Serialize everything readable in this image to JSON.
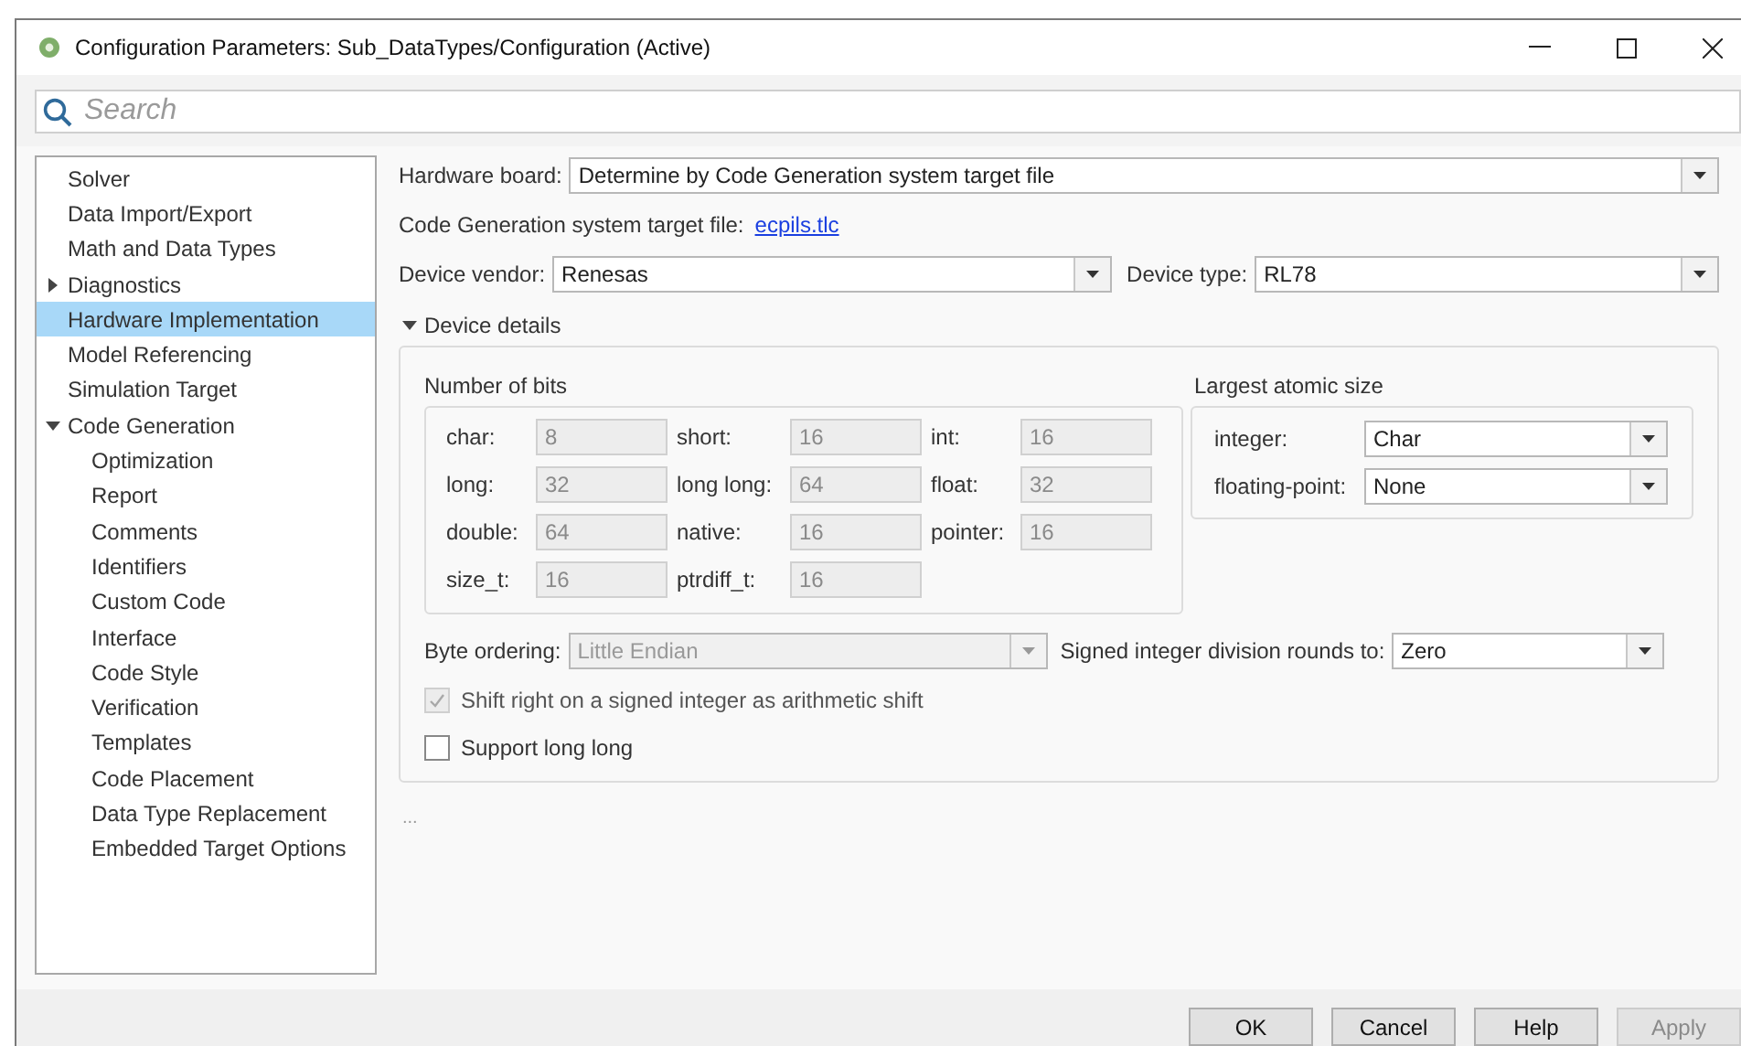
{
  "window": {
    "title": "Configuration Parameters: Sub_DataTypes/Configuration (Active)"
  },
  "search": {
    "placeholder": "Search"
  },
  "sidebar": {
    "items": [
      {
        "label": "Solver",
        "selected": false
      },
      {
        "label": "Data Import/Export",
        "selected": false
      },
      {
        "label": "Math and Data Types",
        "selected": false
      },
      {
        "label": "Diagnostics",
        "selected": false,
        "expanded": false
      },
      {
        "label": "Hardware Implementation",
        "selected": true
      },
      {
        "label": "Model Referencing",
        "selected": false
      },
      {
        "label": "Simulation Target",
        "selected": false
      },
      {
        "label": "Code Generation",
        "selected": false,
        "expanded": true,
        "children": [
          {
            "label": "Optimization",
            "selected": false
          },
          {
            "label": "Report",
            "selected": false
          },
          {
            "label": "Comments",
            "selected": false
          },
          {
            "label": "Identifiers",
            "selected": false
          },
          {
            "label": "Custom Code",
            "selected": false
          },
          {
            "label": "Interface",
            "selected": false
          },
          {
            "label": "Code Style",
            "selected": false
          },
          {
            "label": "Verification",
            "selected": false
          },
          {
            "label": "Templates",
            "selected": false
          },
          {
            "label": "Code Placement",
            "selected": false
          },
          {
            "label": "Data Type Replacement",
            "selected": false
          },
          {
            "label": "Embedded Target Options",
            "selected": false
          }
        ]
      }
    ]
  },
  "hardware_board": {
    "label": "Hardware board:",
    "value": "Determine by Code Generation system target file"
  },
  "target_file": {
    "label": "Code Generation system target file:",
    "link": "ecpils.tlc"
  },
  "device_vendor": {
    "label": "Device vendor:",
    "value": "Renesas"
  },
  "device_type": {
    "label": "Device type:",
    "value": "RL78"
  },
  "device_details": {
    "label": "Device details",
    "expanded": true,
    "number_of_bits": {
      "title": "Number of bits",
      "disabled": true,
      "fields": [
        {
          "label": "char:",
          "value": "8"
        },
        {
          "label": "short:",
          "value": "16"
        },
        {
          "label": "int:",
          "value": "16"
        },
        {
          "label": "long:",
          "value": "32"
        },
        {
          "label": "long long:",
          "value": "64"
        },
        {
          "label": "float:",
          "value": "32"
        },
        {
          "label": "double:",
          "value": "64"
        },
        {
          "label": "native:",
          "value": "16"
        },
        {
          "label": "pointer:",
          "value": "16"
        },
        {
          "label": "size_t:",
          "value": "16"
        },
        {
          "label": "ptrdiff_t:",
          "value": "16"
        }
      ]
    },
    "largest_atomic_size": {
      "title": "Largest atomic size",
      "fields": [
        {
          "label": "integer:",
          "value": "Char"
        },
        {
          "label": "floating-point:",
          "value": "None"
        }
      ]
    },
    "byte_ordering": {
      "label": "Byte ordering:",
      "value": "Little Endian",
      "disabled": true
    },
    "division_rounding": {
      "label": "Signed integer division rounds to:",
      "value": "Zero"
    },
    "checkboxes": [
      {
        "label": "Shift right on a signed integer as arithmetic shift",
        "checked": true,
        "disabled": true
      },
      {
        "label": "Support long long",
        "checked": false,
        "disabled": false
      }
    ]
  },
  "more": "...",
  "buttons": [
    {
      "label": "OK",
      "disabled": false
    },
    {
      "label": "Cancel",
      "disabled": false
    },
    {
      "label": "Help",
      "disabled": false
    },
    {
      "label": "Apply",
      "disabled": true
    }
  ]
}
